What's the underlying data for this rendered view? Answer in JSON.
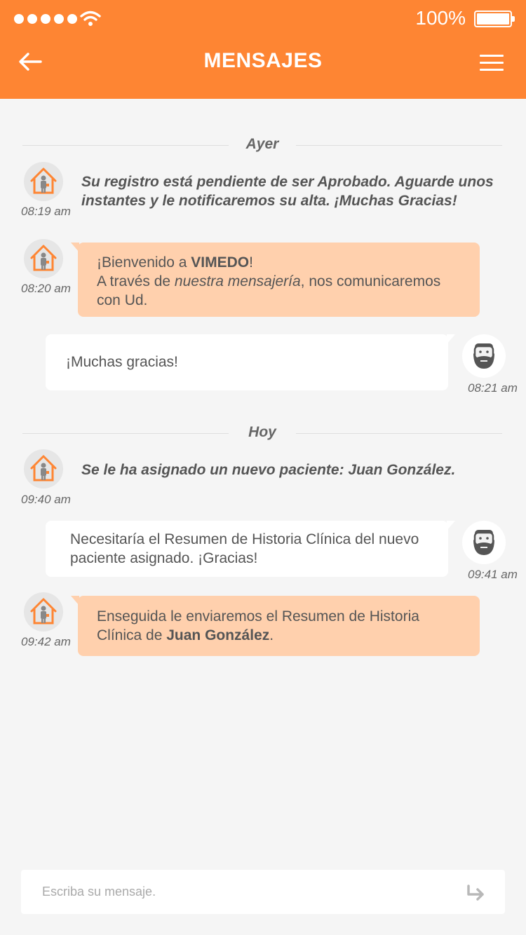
{
  "status_bar": {
    "battery": "100%"
  },
  "header": {
    "title": "MENSAJES"
  },
  "days": [
    {
      "label": "Ayer"
    },
    {
      "label": "Hoy"
    }
  ],
  "messages": [
    {
      "type": "system",
      "time": "08:19 am",
      "text_1": "Su registro está pendiente de ser Aprobado. Aguarde unos",
      "text_2": "instantes y le notificaremos su alta. ¡Muchas Gracias!"
    },
    {
      "type": "incoming",
      "time": "08:20 am",
      "line1_pre": "¡Bienvenido a ",
      "line1_bold": "VIMEDO",
      "line1_post": "!",
      "line2_pre": "A través de ",
      "line2_italic": "nuestra mensajería",
      "line2_post": ", nos comunicaremos",
      "line3": "con Ud."
    },
    {
      "type": "outgoing",
      "time": "08:21 am",
      "text": "¡Muchas gracias!"
    },
    {
      "type": "system",
      "time": "09:40 am",
      "text_pre": "Se le ha asignado un nuevo paciente: ",
      "text_bold": "Juan González."
    },
    {
      "type": "outgoing",
      "time": "09:41 am",
      "line1": "Necesitaría el Resumen de Historia Clínica del nuevo",
      "line2": "paciente asignado. ¡Gracias!"
    },
    {
      "type": "incoming",
      "time": "09:42 am",
      "line1": "Enseguida le enviaremos el Resumen de Historia",
      "line2_pre": "Clínica de ",
      "line2_bold": "Juan González",
      "line2_post": "."
    }
  ],
  "composer": {
    "placeholder": "Escriba su mensaje."
  },
  "colors": {
    "accent": "#fe8533",
    "incoming_bubble": "#ffd0ad",
    "background": "#f5f5f5"
  },
  "icons": {
    "back": "arrow-left-icon",
    "menu": "hamburger-menu-icon",
    "wifi": "wifi-icon",
    "battery": "battery-icon",
    "bot_avatar": "house-doctor-icon",
    "user_avatar": "bearded-man-icon",
    "send": "send-arrow-icon"
  }
}
